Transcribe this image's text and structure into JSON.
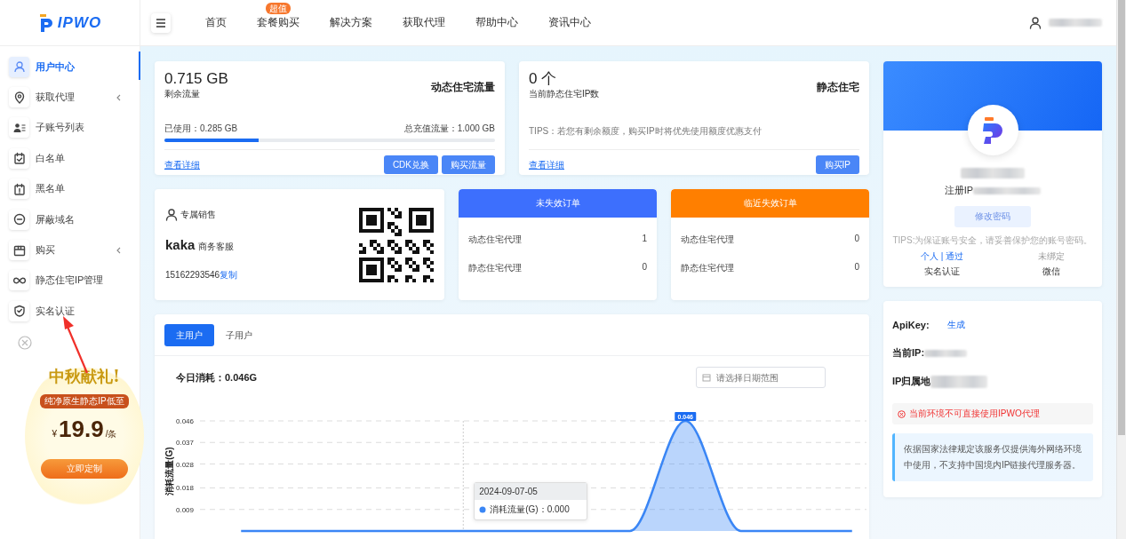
{
  "header": {
    "logo": "IPWO",
    "nav": [
      {
        "label": "首页"
      },
      {
        "label": "套餐购买",
        "badge": "超值"
      },
      {
        "label": "解决方案"
      },
      {
        "label": "获取代理"
      },
      {
        "label": "帮助中心"
      },
      {
        "label": "资讯中心"
      }
    ]
  },
  "sidebar": {
    "items": [
      {
        "label": "用户中心",
        "kind": "link",
        "selected": true
      },
      {
        "label": "获取代理",
        "kind": "group",
        "selected": false
      },
      {
        "label": "子账号列表",
        "kind": "link",
        "selected": false
      },
      {
        "label": "白名单",
        "kind": "link",
        "selected": false
      },
      {
        "label": "黑名单",
        "kind": "link",
        "selected": false
      },
      {
        "label": "屏蔽域名",
        "kind": "link",
        "selected": false
      },
      {
        "label": "购买",
        "kind": "group",
        "selected": false
      },
      {
        "label": "静态住宅IP管理",
        "kind": "link",
        "selected": false
      },
      {
        "label": "实名认证",
        "kind": "link",
        "selected": false
      }
    ]
  },
  "promo": {
    "title": "中秋献礼!",
    "subtitle": "纯净原生静态IP低至",
    "currency": "¥",
    "price": "19.9",
    "unit": "/条",
    "button": "立即定制"
  },
  "dynamic_card": {
    "amount": "0.715 GB",
    "amount_label": "剩余流量",
    "title": "动态住宅流量",
    "used": "已使用：0.285 GB",
    "total": "总充值流量：1.000 GB",
    "level": 0.285,
    "link": "查看详细",
    "buttons": [
      "CDK兑换",
      "购买流量"
    ]
  },
  "static_card": {
    "amount": "0 个",
    "amount_label": "当前静态住宅IP数",
    "title": "静态住宅",
    "tips": "TIPS：若您有剩余额度，购买IP时将优先使用额度优惠支付",
    "link": "查看详细",
    "buttons": [
      "购买IP"
    ]
  },
  "sales_card": {
    "label": "专属销售",
    "name": "kaka",
    "role": "商务客服",
    "phone": "15162293546",
    "copy": "复制"
  },
  "order_cards": [
    {
      "title": "未失效订单",
      "color": "#3d6ffd",
      "rows": [
        {
          "label": "动态住宅代理",
          "value": "1"
        },
        {
          "label": "静态住宅代理",
          "value": "0"
        }
      ]
    },
    {
      "title": "临近失效订单",
      "color": "#ff7f00",
      "rows": [
        {
          "label": "动态住宅代理",
          "value": "0"
        },
        {
          "label": "静态住宅代理",
          "value": "0"
        }
      ]
    }
  ],
  "usage": {
    "tabs": [
      {
        "label": "主用户",
        "selected": true
      },
      {
        "label": "子用户",
        "selected": false
      }
    ],
    "today": "今日消耗：0.046G",
    "date_placeholder": "请选择日期范围",
    "chart_data": {
      "type": "area",
      "ylabel": "消耗流量(G)",
      "ylim": [
        0,
        0.046
      ],
      "yticks": [
        0.009,
        0.018,
        0.028,
        0.037,
        0.046
      ],
      "series": [
        {
          "name": "消耗流量(G)",
          "color": "#3a86f5",
          "values": [
            0,
            0,
            0,
            0,
            0,
            0,
            0,
            0,
            0.046,
            0,
            0,
            0
          ]
        }
      ],
      "grid": true,
      "annotations": [
        {
          "y": 0.046,
          "text": "0.046"
        }
      ]
    },
    "tooltip": {
      "title": "2024-09-07-05",
      "value": "：0.000"
    }
  },
  "profile": {
    "register_ip_label": "注册IP",
    "change_password": "修改密码",
    "tips": "TIPS:为保证账号安全，请妥善保护您的账号密码。",
    "statuses": [
      {
        "value": "个人 | 通过",
        "label": "实名认证",
        "bound": true
      },
      {
        "value": "未绑定",
        "label": "微信",
        "bound": false
      }
    ]
  },
  "api_card": {
    "apikey_label": "ApiKey:",
    "apikey_action": "生成",
    "current_ip_label": "当前IP:",
    "ip_location_label": "IP归属地",
    "warning": "当前环境不可直接使用IPWO代理",
    "notice": "依据国家法律规定该服务仅提供海外网络环境中使用，不支持中国境内IP链接代理服务器。"
  }
}
